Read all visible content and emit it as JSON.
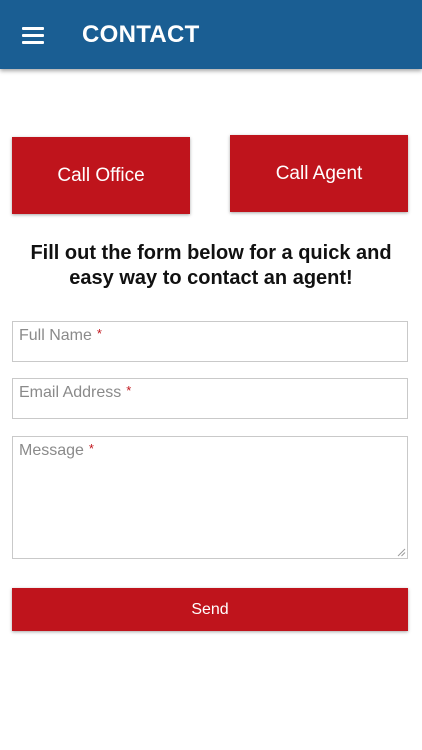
{
  "header": {
    "title": "CONTACT",
    "menu_icon": "hamburger-menu-icon",
    "background_color": "#1a5e93"
  },
  "actions": {
    "call_office_label": "Call Office",
    "call_agent_label": "Call Agent",
    "button_color": "#bf141c"
  },
  "intro_text": "Fill out the form below for a quick and easy way to contact an agent!",
  "form": {
    "full_name": {
      "placeholder": "Full Name",
      "required_mark": "*",
      "value": ""
    },
    "email": {
      "placeholder": "Email Address",
      "required_mark": "*",
      "value": ""
    },
    "message": {
      "placeholder": "Message",
      "required_mark": "*",
      "value": ""
    },
    "send_label": "Send"
  }
}
